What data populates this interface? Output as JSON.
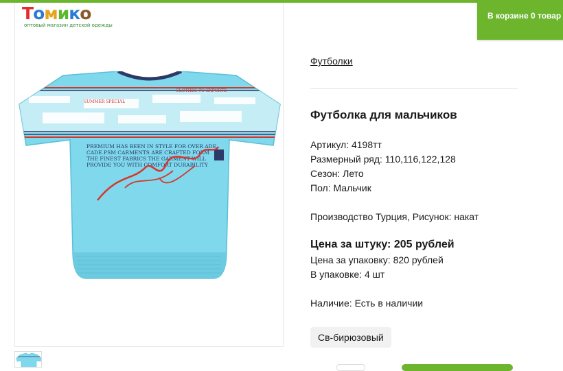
{
  "header": {
    "logo": {
      "wordmark": [
        "Т",
        "о",
        "м",
        "и",
        "к",
        "о"
      ],
      "subtitle": "оптовый магазин детской одежды"
    },
    "cart": {
      "prefix": "В корзине ",
      "count": "0",
      "suffix": " товар"
    }
  },
  "breadcrumb": {
    "category": "Футболки"
  },
  "product": {
    "title": "Футболка для мальчиков",
    "attributes": [
      "Артикул: 4198тт",
      "Размерный ряд: 110,116,122,128",
      "Сезон: Лето",
      "Пол: Мальчик"
    ],
    "production": "Производство Турция, Рисунок: накат",
    "price_unit": "Цена за штуку: 205 рублей",
    "price_pack": "Цена за упаковку: 820 рублей",
    "pack_qty": "В упаковке: 4 шт",
    "availability": "Наличие: Есть в наличии",
    "color": "Св-бирюзовый"
  },
  "image_print": {
    "lines": [
      "PREMIUM HAS BEEN IN STYLE FOR OVER ADE",
      "CADE.PSM CARMENTS ARE CRAFTED FORM",
      "THE FINEST FABRICS THE GARMENT WILL",
      "PROVIDE YOU WITH COMFORT DURABILITY"
    ],
    "stripe_text": [
      "SUMMER SPECIAL",
      "CLOTHES TO EXPORTE"
    ]
  },
  "colors": {
    "accent": "#6cb52d",
    "shirt": "#7fd8ec",
    "shirt_dark": "#5bbfd6",
    "print_navy": "#2b3a67",
    "print_red": "#d7352b",
    "logo_letters": [
      "#e52b2b",
      "#2b7bd6",
      "#e8a21c",
      "#5ab82f",
      "#2b7bd6",
      "#8a5a2b"
    ]
  }
}
